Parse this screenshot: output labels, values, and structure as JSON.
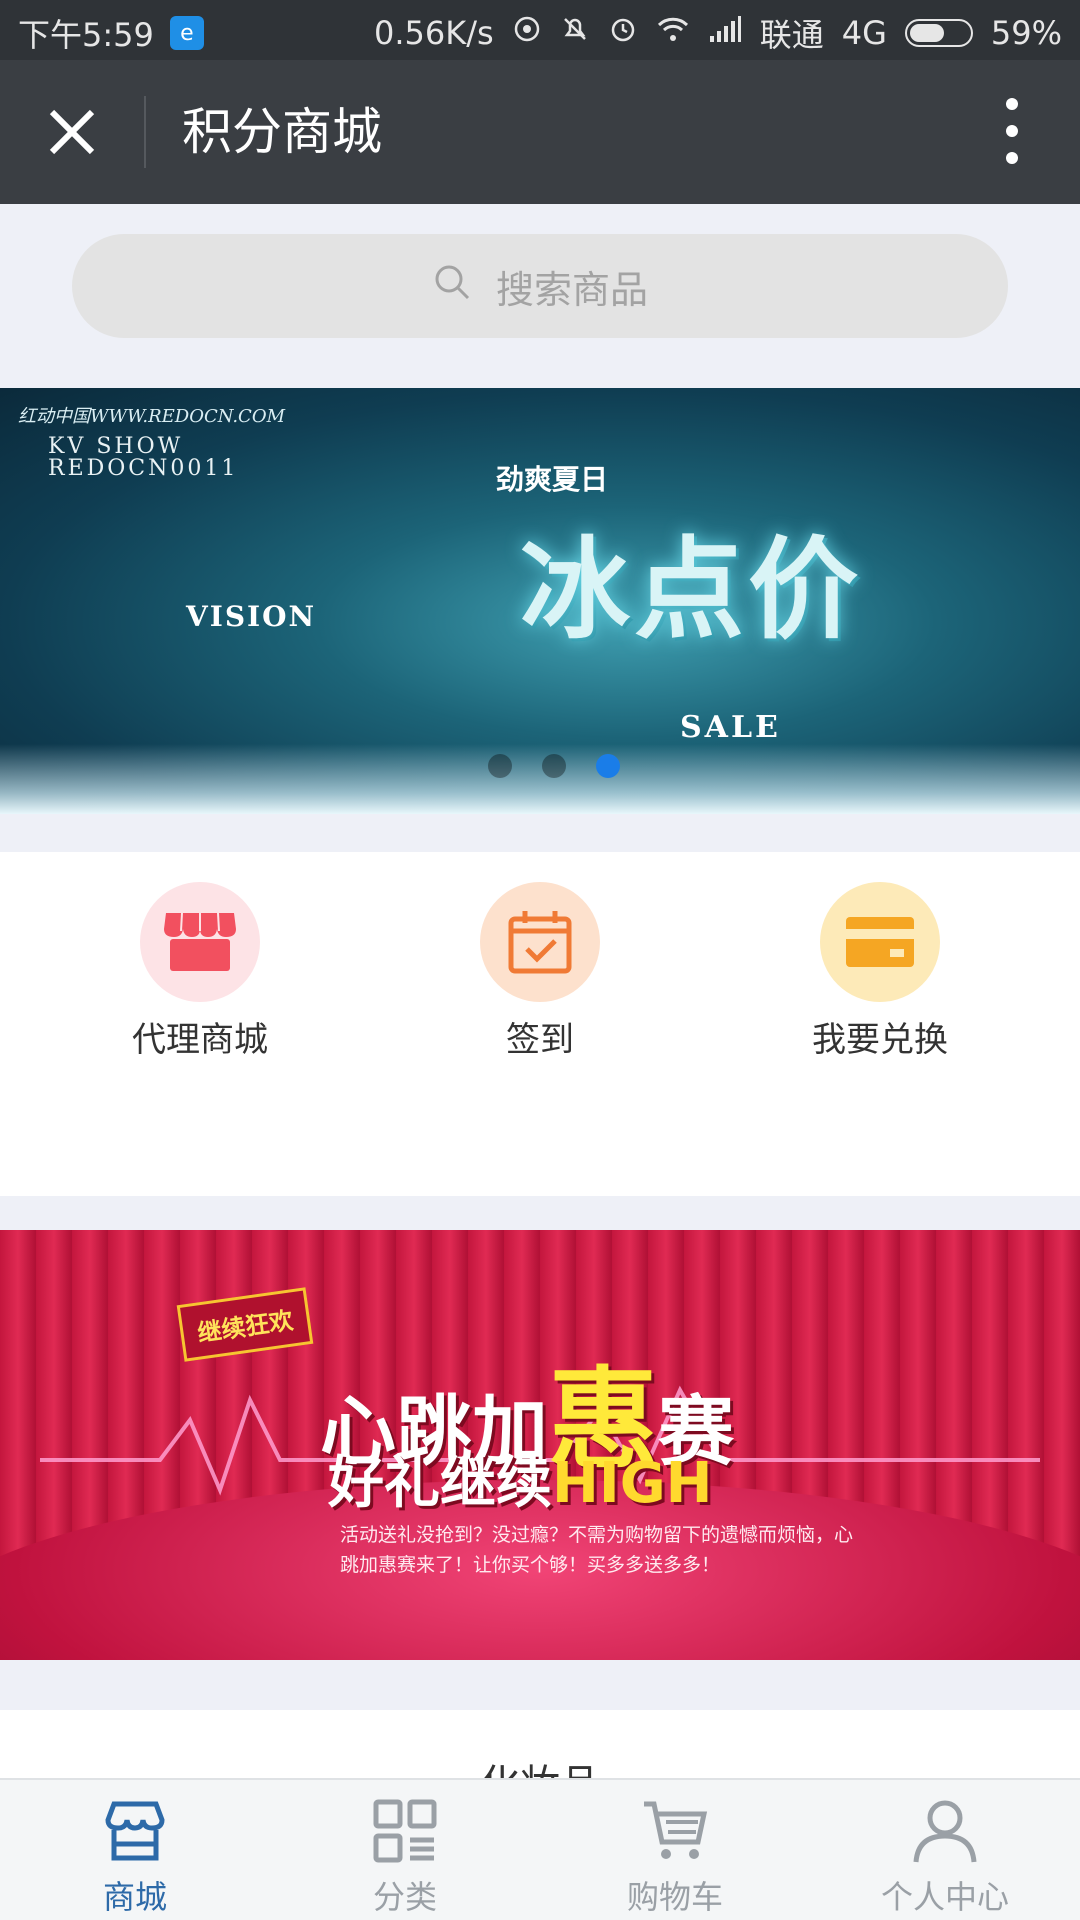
{
  "status_bar": {
    "time": "下午5:59",
    "speed": "0.56K/s",
    "carrier": "联通",
    "network": "4G",
    "battery": "59%",
    "battery_level": 0.59
  },
  "header": {
    "title": "积分商城"
  },
  "search": {
    "placeholder": "搜索商品"
  },
  "banner1": {
    "site_text": "红动中国WWW.REDOCN.COM",
    "kv_line1": "KV SHOW",
    "kv_line2": "REDOCN0011",
    "vision": "VISION",
    "subtitle": "劲爽夏日",
    "headline": "冰点价",
    "sale": "SALE",
    "carousel_total": 3,
    "carousel_active": 3
  },
  "quick_menu": [
    {
      "label": "代理商城",
      "icon": "store-icon",
      "bg": "#fde3e6",
      "color": "#f2505f"
    },
    {
      "label": "签到",
      "icon": "calendar-check-icon",
      "bg": "#fde1cd",
      "color": "#f07a35"
    },
    {
      "label": "我要兑换",
      "icon": "card-icon",
      "bg": "#fdeab8",
      "color": "#f5a623"
    }
  ],
  "banner2": {
    "tag": "继续狂欢",
    "title_a": "心跳加",
    "title_b": "惠",
    "title_c": "赛",
    "line2_a": "好礼继续",
    "line2_b": "HIGH",
    "desc": "活动送礼没抢到？没过瘾？不需为购物留下的遗憾而烦恼，心跳加惠赛来了！让你买个够！买多多送多多！"
  },
  "section": {
    "heading": "化妆品"
  },
  "tabbar": {
    "items": [
      {
        "label": "商城",
        "icon": "shop-icon",
        "active": true
      },
      {
        "label": "分类",
        "icon": "category-icon",
        "active": false
      },
      {
        "label": "购物车",
        "icon": "cart-icon",
        "active": false
      },
      {
        "label": "个人中心",
        "icon": "user-icon",
        "active": false
      }
    ]
  },
  "colors": {
    "accent": "#2d6aa8",
    "header_bg": "#3a3e43",
    "page_bg": "#eef0f7"
  }
}
